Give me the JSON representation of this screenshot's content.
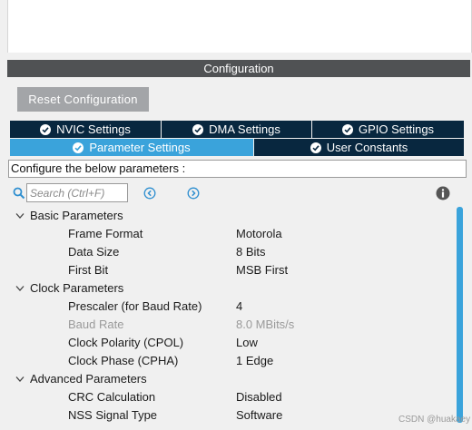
{
  "panel": {
    "title": "Configuration"
  },
  "toolbar": {
    "reset_label": "Reset Configuration"
  },
  "tabs_row1": [
    {
      "label": "NVIC Settings"
    },
    {
      "label": "DMA Settings"
    },
    {
      "label": "GPIO Settings"
    }
  ],
  "tabs_row2": [
    {
      "label": "Parameter Settings",
      "active": true
    },
    {
      "label": "User Constants",
      "active": false
    }
  ],
  "description": "Configure the below parameters :",
  "search": {
    "placeholder": "Search (Ctrl+F)",
    "value": ""
  },
  "groups": [
    {
      "label": "Basic Parameters",
      "params": [
        {
          "name": "Frame Format",
          "value": "Motorola"
        },
        {
          "name": "Data Size",
          "value": "8 Bits"
        },
        {
          "name": "First Bit",
          "value": "MSB First"
        }
      ]
    },
    {
      "label": "Clock Parameters",
      "params": [
        {
          "name": "Prescaler (for Baud Rate)",
          "value": "4"
        },
        {
          "name": "Baud Rate",
          "value": "8.0 MBits/s",
          "disabled": true
        },
        {
          "name": "Clock Polarity (CPOL)",
          "value": "Low"
        },
        {
          "name": "Clock Phase (CPHA)",
          "value": "1 Edge"
        }
      ]
    },
    {
      "label": "Advanced Parameters",
      "params": [
        {
          "name": "CRC Calculation",
          "value": "Disabled"
        },
        {
          "name": "NSS Signal Type",
          "value": "Software"
        }
      ]
    }
  ],
  "watermark": "CSDN @huakaey",
  "colors": {
    "header": "#505254",
    "tab_dark": "#08273f",
    "tab_active": "#3aa3db",
    "scrollbar": "#3aa3db"
  },
  "icons": {
    "tab_check": "check-circle-icon",
    "search": "search-icon",
    "prev": "arrow-left-circle-icon",
    "next": "arrow-right-circle-icon",
    "info": "info-icon",
    "expand": "chevron-down-icon"
  }
}
